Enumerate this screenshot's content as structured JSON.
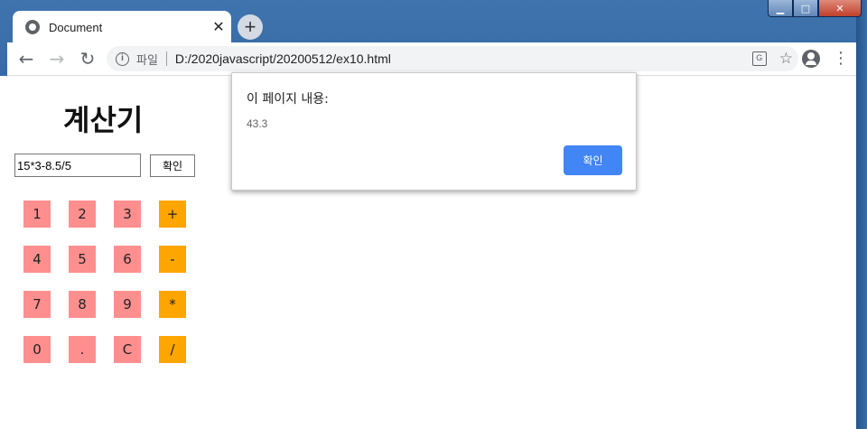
{
  "window": {
    "minimize_symbol": "▁",
    "maximize_symbol": "□",
    "close_symbol": "✕"
  },
  "tab": {
    "title": "Document",
    "close_symbol": "✕",
    "icon": "globe-icon"
  },
  "new_tab_symbol": "+",
  "toolbar": {
    "back_symbol": "←",
    "forward_symbol": "→",
    "reload_symbol": "↻",
    "info_symbol": "i",
    "scheme_label": "파일",
    "url": "D:/2020javascript/20200512/ex10.html",
    "translate_symbol": "G",
    "star_symbol": "☆",
    "menu_symbol": "⋮"
  },
  "page": {
    "title": "계산기",
    "expression_value": "15*3-8.5/5",
    "confirm_label": "확인",
    "keys": [
      {
        "label": "1",
        "kind": "num"
      },
      {
        "label": "2",
        "kind": "num"
      },
      {
        "label": "3",
        "kind": "num"
      },
      {
        "label": "+",
        "kind": "op"
      },
      {
        "label": "4",
        "kind": "num"
      },
      {
        "label": "5",
        "kind": "num"
      },
      {
        "label": "6",
        "kind": "num"
      },
      {
        "label": "-",
        "kind": "op"
      },
      {
        "label": "7",
        "kind": "num"
      },
      {
        "label": "8",
        "kind": "num"
      },
      {
        "label": "9",
        "kind": "num"
      },
      {
        "label": "*",
        "kind": "op"
      },
      {
        "label": "0",
        "kind": "num"
      },
      {
        "label": ".",
        "kind": "num"
      },
      {
        "label": "C",
        "kind": "num"
      },
      {
        "label": "/",
        "kind": "op"
      }
    ],
    "colors": {
      "number_key": "#ff8f8f",
      "operator_key": "#ffa500"
    }
  },
  "dialog": {
    "title": "이 페이지 내용:",
    "message": "43.3",
    "ok_label": "확인",
    "ok_color": "#4285f4"
  }
}
